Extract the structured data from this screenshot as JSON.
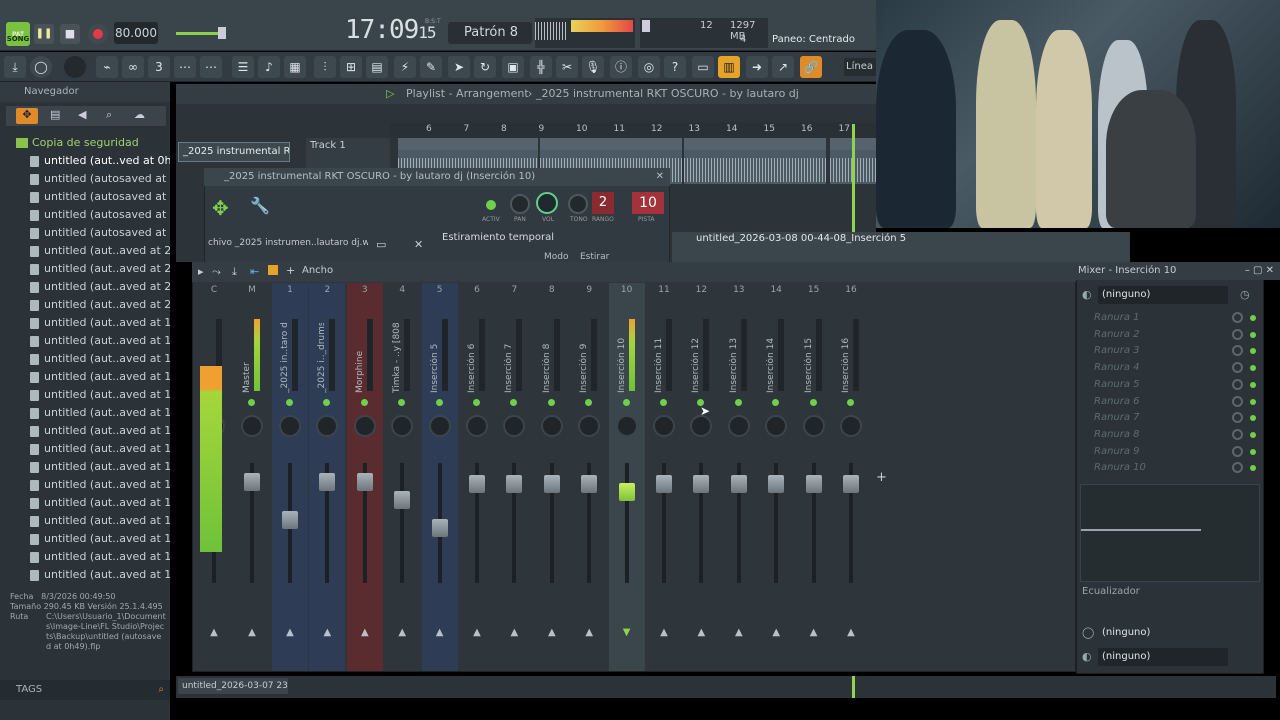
{
  "transport": {
    "song_label": "SONG",
    "pat_label": "PAT",
    "tempo": "80.000",
    "time_main": "17:09",
    "time_sub": "15",
    "time_unit": "B:S:T",
    "pattern": "Patrón 8",
    "cpu": "12",
    "ram": "1297 MB",
    "voices": "4",
    "hint": "Paneo: Centrado",
    "snap_label": "Línea"
  },
  "browser": {
    "title": "Navegador",
    "folder": "Copia de seguridad",
    "items": [
      "untitled (aut..ved at 0h49)",
      "untitled (autosaved at 0h39)",
      "untitled (autosaved at 0h28)",
      "untitled (autosaved at 0h17)",
      "untitled (autosaved at 0h07)",
      "untitled (aut..aved at 23h56)",
      "untitled (aut..aved at 23h45)",
      "untitled (aut..aved at 23h35)",
      "untitled (aut..aved at 22h42)",
      "untitled (aut..aved at 14h24)",
      "untitled (aut..aved at 14h59)",
      "untitled (aut..aved at 14h47)",
      "untitled (aut..aved at 14h37)",
      "untitled (aut..aved at 14h27)",
      "untitled (aut..aved at 13h59)",
      "untitled (aut..aved at 13h49)",
      "untitled (aut..aved at 15h11)",
      "untitled (aut..aved at 14h43)",
      "untitled (aut..aved at 14h31)",
      "untitled (aut..aved at 13h42)",
      "untitled (aut..aved at 11h56)",
      "untitled (aut..aved at 11h41)",
      "untitled (aut..aved at 11h21)",
      "untitled (aut..aved at 12h11)"
    ],
    "info_fecha_label": "Fecha",
    "info_fecha": "8/3/2026 00:49:50",
    "info_tam_label": "Tamaño",
    "info_tam": "290.45 KB",
    "info_ver_label": "Versión",
    "info_ver": "25.1.4.495",
    "info_ruta_label": "Ruta",
    "info_ruta": "C:\\Users\\Usuario_1\\Documents\\Image-Line\\FL Studio\\Projects\\Backup\\untitled (autosaved at 0h49).flp",
    "tags": "TAGS"
  },
  "playlist": {
    "breadcrumb": "Playlist - Arrangement",
    "project": "_2025 instrumental RKT OSCURO - by lautaro dj",
    "pattern_item": "_2025 instrumental R..",
    "track": "Track 1",
    "ruler": [
      "6",
      "7",
      "8",
      "9",
      "10",
      "11",
      "12",
      "13",
      "14",
      "15",
      "16",
      "17"
    ],
    "clips": [
      "_2025 instrumen.. - by lautaro dj",
      "_2025 instru..y lautaro dj",
      "_2025 instrume.. - by lautaro dj",
      "_2025 i"
    ],
    "audio_clip": "untitled_2026-03-08 00-44-08_Inserción 5",
    "bottom_clip": "untitled_2026-03-07 23-..."
  },
  "channel": {
    "title": "_2025 instrumental RKT OSCURO - by lautaro dj (Inserción 10)",
    "sample": "chivo _2025 instrumen..lautaro dj.wav",
    "stretch": "Estiramiento temporal",
    "mode_label": "Modo",
    "mode_value": "Estirar",
    "k_active": "ACTIV",
    "k_pan": "PAN",
    "k_vol": "VOL",
    "k_tono": "TONO",
    "k_rango": "RANGO",
    "k_pista": "PISTA",
    "rango": "2",
    "pista": "10"
  },
  "mixer": {
    "width_label": "Ancho",
    "strips": [
      {
        "num": "C",
        "name": ""
      },
      {
        "num": "M",
        "name": "Master"
      },
      {
        "num": "1",
        "name": "_2025 in..taro dj"
      },
      {
        "num": "2",
        "name": "_2025 i.._drums"
      },
      {
        "num": "3",
        "name": "Morphine"
      },
      {
        "num": "4",
        "name": "Timka - ..y [808]"
      },
      {
        "num": "5",
        "name": "Inserción 5"
      },
      {
        "num": "6",
        "name": "Inserción 6"
      },
      {
        "num": "7",
        "name": "Inserción 7"
      },
      {
        "num": "8",
        "name": "Inserción 8"
      },
      {
        "num": "9",
        "name": "Inserción 9"
      },
      {
        "num": "10",
        "name": "Inserción 10"
      },
      {
        "num": "11",
        "name": "Inserción 11"
      },
      {
        "num": "12",
        "name": "Inserción 12"
      },
      {
        "num": "13",
        "name": "Inserción 13"
      },
      {
        "num": "14",
        "name": "Inserción 14"
      },
      {
        "num": "15",
        "name": "Inserción 15"
      },
      {
        "num": "16",
        "name": "Inserción 16"
      }
    ]
  },
  "inspector": {
    "title": "Mixer - Inserción 10",
    "input": "(ninguno)",
    "slots": [
      "Ranura 1",
      "Ranura 2",
      "Ranura 3",
      "Ranura 4",
      "Ranura 5",
      "Ranura 6",
      "Ranura 7",
      "Ranura 8",
      "Ranura 9",
      "Ranura 10"
    ],
    "eq_label": "Ecualizador",
    "out1": "(ninguno)",
    "out2": "(ninguno)"
  },
  "colors": {
    "accent": "#79c241",
    "record": "#e13b45",
    "clip": "#4b5a64",
    "strip_red": "#5a2b2f",
    "strip_blue": "#2f3c55"
  }
}
